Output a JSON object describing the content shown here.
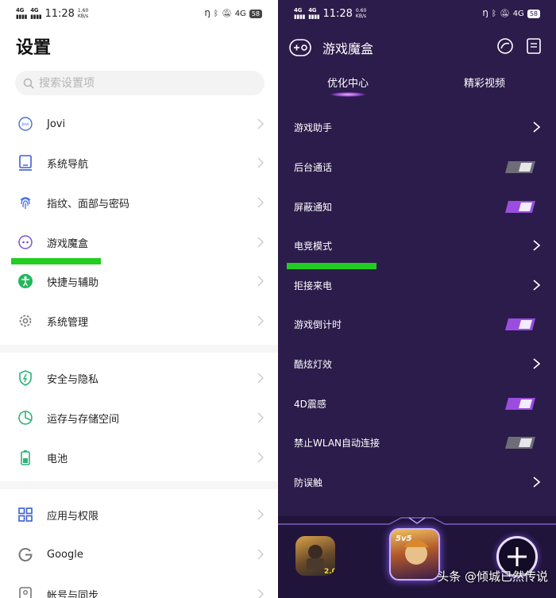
{
  "settings": {
    "status": {
      "signal_left": "4G",
      "signal_right": "4G",
      "time": "11:28",
      "speed": "1.60",
      "speed_unit": "KB/s",
      "net": "4G",
      "battery": "58"
    },
    "title": "设置",
    "search": {
      "placeholder": "搜索设置项",
      "value": ""
    },
    "items": [
      {
        "label": "Jovi",
        "icon": "jovi-icon"
      },
      {
        "label": "系统导航",
        "icon": "tablet-icon"
      },
      {
        "label": "指纹、面部与密码",
        "icon": "fingerprint-icon"
      },
      {
        "label": "游戏魔盒",
        "icon": "gamepad-icon"
      },
      {
        "label": "快捷与辅助",
        "icon": "accessibility-icon"
      },
      {
        "label": "系统管理",
        "icon": "gear-icon"
      },
      {
        "label": "安全与隐私",
        "icon": "shield-icon"
      },
      {
        "label": "运存与存储空间",
        "icon": "pie-chart-icon"
      },
      {
        "label": "电池",
        "icon": "battery-icon"
      },
      {
        "label": "应用与权限",
        "icon": "apps-grid-icon"
      },
      {
        "label": "Google",
        "icon": "google-icon"
      },
      {
        "label": "帐号与同步",
        "icon": "account-icon"
      }
    ]
  },
  "gamebox": {
    "status": {
      "signal_left": "4G",
      "signal_right": "4G",
      "time": "11:28",
      "speed": "0.60",
      "speed_unit": "KB/s",
      "net": "4G",
      "battery": "58"
    },
    "title": "游戏魔盒",
    "tabs": [
      {
        "label": "优化中心",
        "active": true
      },
      {
        "label": "精彩视频",
        "active": false
      }
    ],
    "items": [
      {
        "label": "游戏助手",
        "control": "chevron"
      },
      {
        "label": "后台通话",
        "control": "toggle",
        "on": false
      },
      {
        "label": "屏蔽通知",
        "control": "toggle",
        "on": true
      },
      {
        "label": "电竞模式",
        "control": "chevron"
      },
      {
        "label": "拒接来电",
        "control": "chevron"
      },
      {
        "label": "游戏倒计时",
        "control": "toggle",
        "on": true
      },
      {
        "label": "酷炫灯效",
        "control": "chevron"
      },
      {
        "label": "4D震感",
        "control": "toggle",
        "on": true
      },
      {
        "label": "禁止WLAN自动连接",
        "control": "toggle",
        "on": false
      },
      {
        "label": "防误触",
        "control": "chevron"
      }
    ],
    "dock_apps": [
      {
        "name": "pubg-app-icon",
        "badge": "2.0"
      },
      {
        "name": "honor-of-kings-app-icon",
        "badge": "5v5"
      }
    ],
    "watermark": "头条 @倾城已然传说"
  },
  "colors": {
    "highlight": "#22cc22",
    "gamebox_bg": "#2b1c4b",
    "toggle_on": "#9b4de0",
    "toggle_off": "#5a5a66"
  }
}
